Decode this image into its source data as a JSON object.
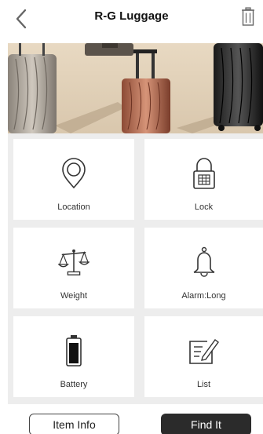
{
  "header": {
    "title": "R-G Luggage",
    "back_icon": "chevron-left-icon",
    "trash_icon": "trash-icon"
  },
  "banner": {
    "image": "luggage-photo"
  },
  "tiles": [
    {
      "label": "Location",
      "icon": "location-pin-icon"
    },
    {
      "label": "Lock",
      "icon": "lock-icon"
    },
    {
      "label": "Weight",
      "icon": "scale-icon"
    },
    {
      "label": "Alarm:Long",
      "icon": "bell-icon"
    },
    {
      "label": "Battery",
      "icon": "battery-icon"
    },
    {
      "label": "List",
      "icon": "list-edit-icon"
    }
  ],
  "buttons": {
    "item_info": "Item Info",
    "find_it": "Find It"
  },
  "colors": {
    "primary_dark": "#2b2b2b",
    "grid_bg": "#ededed"
  }
}
